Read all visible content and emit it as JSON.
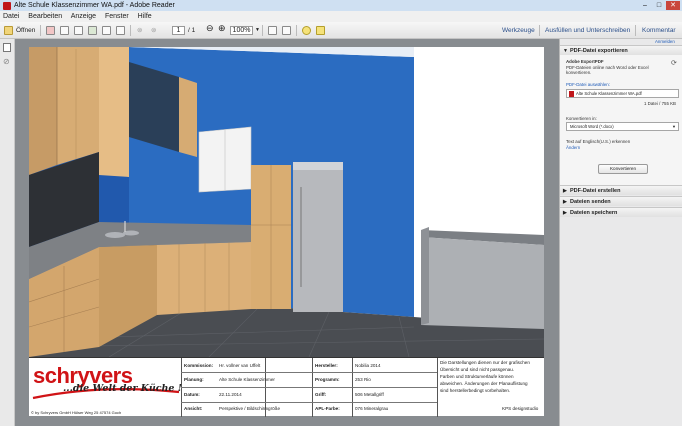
{
  "window": {
    "title": "Alte Schule Klassenzimmer WA.pdf - Adobe Reader"
  },
  "menu": [
    "Datei",
    "Bearbeiten",
    "Anzeige",
    "Fenster",
    "Hilfe"
  ],
  "toolbar": {
    "open_label": "Öffnen",
    "page_current": "1",
    "page_total": "/ 1",
    "zoom": "100%"
  },
  "tabs": {
    "tools": "Werkzeuge",
    "fill_sign": "Ausfüllen und Unterschreiben",
    "comment": "Kommentar",
    "signin": "Anmelden"
  },
  "panel": {
    "export_header": "PDF-Datei exportieren",
    "service_name": "Adobe ExportPDF",
    "service_desc_1": "PDF-Dateien online nach Word oder Excel",
    "service_desc_2": "konvertieren.",
    "select_label": "PDF-Datei auswählen:",
    "file_name": "Alte Schule Klassenzimmer WA.pdf",
    "file_count": "1 Datei / 755 KB",
    "convert_to_label": "Konvertieren in:",
    "convert_to_value": "Microsoft Word (*.docx)",
    "ocr_text": "Text auf Englisch(U.S.) erkennen",
    "ocr_change": "Ändern",
    "convert_button": "Konvertieren",
    "create_header": "PDF-Datei erstellen",
    "send_header": "Dateien senden",
    "save_header": "Dateien speichern"
  },
  "titleblock": {
    "brand": "schryvers",
    "slogan": "...die Welt der Küche !",
    "copyright": "© by Schryvers GmbH Hülser Weg 25 47574 Goch",
    "labels": {
      "kommission": "Kommission:",
      "planung": "Planung:",
      "datum": "Datum:",
      "ansicht": "Ansicht:",
      "hersteller": "Hersteller:",
      "programm": "Programm:",
      "griff": "Griff:",
      "apl": "APL-Farbe:"
    },
    "values": {
      "kommission": "Hr. vollner van Uffelt",
      "planung": "Alte Schule Klassenzimmer",
      "datum": "22.11.2014",
      "ansicht": "Perspektive / Bildschirmgröße",
      "hersteller": "Nobilia 2014",
      "programm": "253 Rio",
      "griff": "506 Metallgriff",
      "apl": "076 Mineralgrau"
    },
    "disclaimer": [
      "Die Darstellungen dienen nur der grafischen",
      "Übersicht und sind nicht passgenau.",
      "Farben und Strukturverläufe können",
      "abweichen. Änderungen der Planauflistung",
      "sind herstellerbedingt vorbehalten."
    ],
    "studio": "KPS designstudio"
  },
  "colors": {
    "wall_blue": "#2b6cc1",
    "brand_red": "#d01316",
    "panel_bg": "#e9e9ea"
  }
}
